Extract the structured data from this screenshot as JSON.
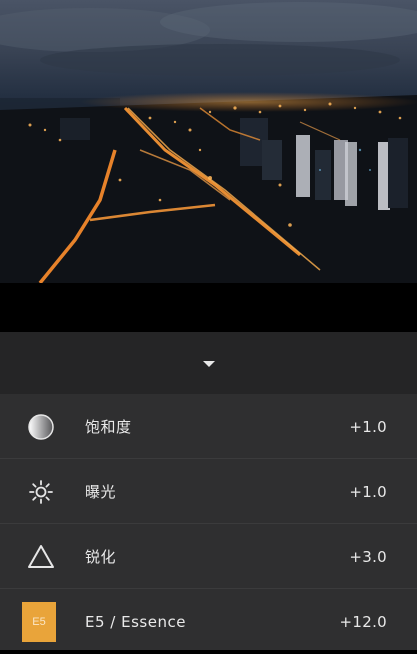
{
  "photo": {
    "description_icon": "photo-preview"
  },
  "collapse": {
    "icon": "chevron-down-icon"
  },
  "adjustments": [
    {
      "icon": "saturation-icon",
      "label": "饱和度",
      "value": "+1.0"
    },
    {
      "icon": "exposure-icon",
      "label": "曝光",
      "value": "+1.0"
    },
    {
      "icon": "sharpen-icon",
      "label": "锐化",
      "value": "+3.0"
    },
    {
      "icon": "preset-badge",
      "badge_text": "E5",
      "label": "E5 / Essence",
      "value": "+12.0"
    }
  ],
  "colors": {
    "panel_bg": "#2f2f30",
    "collapse_bg": "#252526",
    "preset_accent": "#e9a43a"
  }
}
